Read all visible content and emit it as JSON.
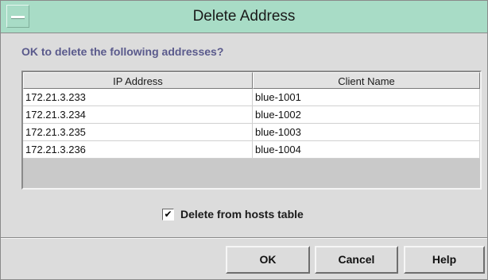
{
  "window": {
    "title": "Delete Address"
  },
  "prompt": "OK to delete the following addresses?",
  "table": {
    "columns": [
      "IP Address",
      "Client Name"
    ],
    "rows": [
      [
        "172.21.3.233",
        "blue-1001"
      ],
      [
        "172.21.3.234",
        "blue-1002"
      ],
      [
        "172.21.3.235",
        "blue-1003"
      ],
      [
        "172.21.3.236",
        "blue-1004"
      ]
    ]
  },
  "options": {
    "delete_hosts_label": "Delete from hosts table",
    "delete_hosts_checked": true,
    "check_glyph": "✔"
  },
  "buttons": {
    "ok": "OK",
    "cancel": "Cancel",
    "help": "Help"
  },
  "colors": {
    "titlebar": "#a8dcc6",
    "dialog_bg": "#dcdcdc",
    "prompt_text": "#5a5a8c"
  }
}
